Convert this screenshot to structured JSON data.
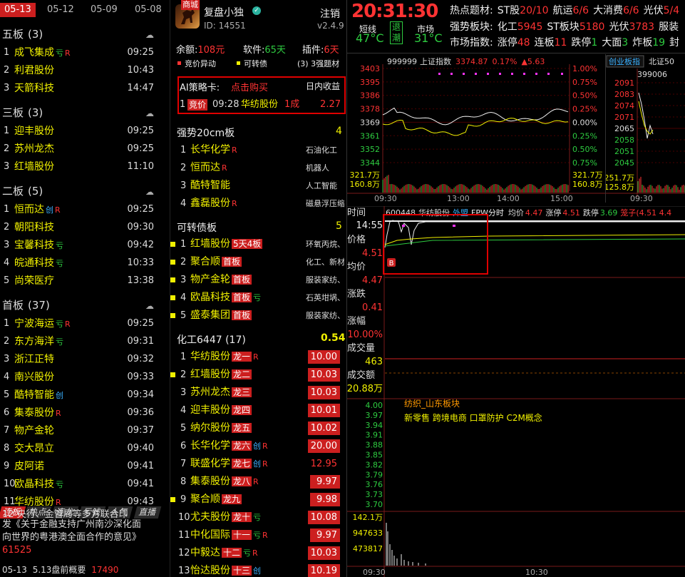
{
  "left": {
    "date_tabs": [
      "05-13",
      "05-12",
      "05-09",
      "05-08"
    ],
    "sections": [
      {
        "title": "五板",
        "count": "(3)",
        "rows": [
          {
            "n": "1",
            "name": "成飞集成",
            "tags": [
              {
                "t": "亏",
                "c": "k"
              },
              {
                "t": "R",
                "c": "r"
              }
            ],
            "time": "09:25"
          },
          {
            "n": "2",
            "name": "利君股份",
            "tags": [],
            "time": "10:43"
          },
          {
            "n": "3",
            "name": "天箭科技",
            "tags": [],
            "time": "14:47"
          }
        ]
      },
      {
        "title": "三板",
        "count": "(3)",
        "rows": [
          {
            "n": "1",
            "name": "迎丰股份",
            "tags": [],
            "time": "09:25"
          },
          {
            "n": "2",
            "name": "苏州龙杰",
            "tags": [],
            "time": "09:25"
          },
          {
            "n": "3",
            "name": "红墙股份",
            "tags": [],
            "time": "11:10"
          }
        ]
      },
      {
        "title": "二板",
        "count": "(5)",
        "rows": [
          {
            "n": "1",
            "name": "恒而达",
            "tags": [
              {
                "t": "创",
                "c": "c"
              },
              {
                "t": "R",
                "c": "r"
              }
            ],
            "time": "09:25"
          },
          {
            "n": "2",
            "name": "朝阳科技",
            "tags": [],
            "time": "09:30"
          },
          {
            "n": "3",
            "name": "宝馨科技",
            "tags": [
              {
                "t": "亏",
                "c": "k"
              }
            ],
            "time": "09:42"
          },
          {
            "n": "4",
            "name": "皖通科技",
            "tags": [
              {
                "t": "亏",
                "c": "k"
              }
            ],
            "time": "10:33"
          },
          {
            "n": "5",
            "name": "尚荣医疗",
            "tags": [],
            "time": "13:38"
          }
        ]
      },
      {
        "title": "首板",
        "count": "(37)",
        "rows": [
          {
            "n": "1",
            "name": "宁波海运",
            "tags": [
              {
                "t": "亏",
                "c": "k"
              },
              {
                "t": "R",
                "c": "r"
              }
            ],
            "time": "09:25"
          },
          {
            "n": "2",
            "name": "东方海洋",
            "tags": [
              {
                "t": "亏",
                "c": "k"
              }
            ],
            "time": "09:31"
          },
          {
            "n": "3",
            "name": "浙江正特",
            "tags": [],
            "time": "09:32"
          },
          {
            "n": "4",
            "name": "南兴股份",
            "tags": [],
            "time": "09:33"
          },
          {
            "n": "5",
            "name": "酷特智能",
            "tags": [
              {
                "t": "创",
                "c": "c"
              }
            ],
            "time": "09:34"
          },
          {
            "n": "6",
            "name": "集泰股份",
            "tags": [
              {
                "t": "R",
                "c": "r"
              }
            ],
            "time": "09:36"
          },
          {
            "n": "7",
            "name": "物产金轮",
            "tags": [],
            "time": "09:37"
          },
          {
            "n": "8",
            "name": "交大昂立",
            "tags": [],
            "time": "09:40"
          },
          {
            "n": "9",
            "name": "皮阿诺",
            "tags": [],
            "time": "09:41"
          },
          {
            "n": "10",
            "name": "欧晶科技",
            "tags": [
              {
                "t": "亏",
                "c": "k"
              }
            ],
            "time": "09:41"
          },
          {
            "n": "11",
            "name": "华纺股份",
            "tags": [
              {
                "t": "R",
                "c": "r"
              }
            ],
            "time": "09:43"
          }
        ]
      }
    ],
    "bottom_tabs": [
      "连板",
      "热点",
      "连龙",
      "亏钱",
      "人气",
      "直播"
    ],
    "news_line1": "发《关于金融支持广州南沙深化面",
    "news_line2": "向世界的粤港澳全面合作的意见》",
    "news_line0": "12 央行、金管局等多方联合印",
    "news_num": "61525",
    "footer_date": "05-13",
    "footer_text": "5.13盘前概要",
    "footer_num": "17490"
  },
  "mid": {
    "shop_badge": "商城",
    "user": "复盘小独",
    "user_id": "ID: 14551",
    "logout": "注销",
    "version": "v2.4.9",
    "balance_label": "余额:",
    "balance_value": "108元",
    "software_label": "软件:",
    "software_value": "65天",
    "plugin_label": "插件:",
    "plugin_value": "6天",
    "legend": [
      {
        "t": "竞价异动",
        "c": "#ff3333"
      },
      {
        "t": "可转债",
        "c": "#f0f000"
      },
      {
        "t": "(3) 3强题材",
        "c": "#eee"
      }
    ],
    "ai_label": "AI策略卡:",
    "ai_buy": "点击购买",
    "ai_income": "日内收益",
    "ai_row": {
      "badge": "竞价",
      "time": "09:28",
      "name": "华纺股份",
      "share": "1成",
      "ret": "2.27"
    },
    "strong20_title": "强势20cm板",
    "strong20_count": "4",
    "strong20": [
      {
        "n": "1",
        "name": "长华化学",
        "tag": "R",
        "ind": "石油化工"
      },
      {
        "n": "2",
        "name": "恒而达",
        "tag": "R",
        "ind": "机器人"
      },
      {
        "n": "3",
        "name": "酷特智能",
        "tag": "",
        "ind": "人工智能"
      },
      {
        "n": "4",
        "name": "鑫磊股份",
        "tag": "R",
        "ind": "磁悬浮压缩"
      }
    ],
    "bond_title": "可转债板",
    "bond_count": "5",
    "bonds": [
      {
        "n": "1",
        "name": "红墙股份",
        "badge": "5天4板",
        "tag": "",
        "ind": "环氧丙烷、"
      },
      {
        "n": "2",
        "name": "聚合顺",
        "badge": "首板",
        "tag": "",
        "ind": "化工、新材"
      },
      {
        "n": "3",
        "name": "物产金轮",
        "badge": "首板",
        "tag": "",
        "ind": "服装家纺、"
      },
      {
        "n": "4",
        "name": "欧晶科技",
        "badge": "首板",
        "tag": "亏",
        "ind": "石英坩埚、"
      },
      {
        "n": "5",
        "name": "盛泰集团",
        "badge": "首板",
        "tag": "",
        "ind": "服装家纺、"
      }
    ],
    "chem_title": "化工6447",
    "chem_count": "(17)",
    "chem_pct": "0.54",
    "chem": [
      {
        "n": "1",
        "name": "华纺股份",
        "badge": "龙一",
        "tags": [
          {
            "t": "R",
            "c": "r"
          }
        ],
        "pct": "10.00",
        "sq": false,
        "plain": false
      },
      {
        "n": "2",
        "name": "红墙股份",
        "badge": "龙二",
        "tags": [],
        "pct": "10.03",
        "sq": true,
        "plain": false
      },
      {
        "n": "3",
        "name": "苏州龙杰",
        "badge": "龙三",
        "tags": [],
        "pct": "10.03",
        "sq": false,
        "plain": false
      },
      {
        "n": "4",
        "name": "迎丰股份",
        "badge": "龙四",
        "tags": [],
        "pct": "10.01",
        "sq": false,
        "plain": false
      },
      {
        "n": "5",
        "name": "纳尔股份",
        "badge": "龙五",
        "tags": [],
        "pct": "10.02",
        "sq": false,
        "plain": false
      },
      {
        "n": "6",
        "name": "长华化学",
        "badge": "龙六",
        "tags": [
          {
            "t": "创",
            "c": "c"
          },
          {
            "t": "R",
            "c": "r"
          }
        ],
        "pct": "20.00",
        "sq": false,
        "plain": false
      },
      {
        "n": "7",
        "name": "联盛化学",
        "badge": "龙七",
        "tags": [
          {
            "t": "创",
            "c": "c"
          },
          {
            "t": "R",
            "c": "r"
          }
        ],
        "pct": "12.95",
        "sq": false,
        "plain": true
      },
      {
        "n": "8",
        "name": "集泰股份",
        "badge": "龙八",
        "tags": [
          {
            "t": "R",
            "c": "r"
          }
        ],
        "pct": "9.97",
        "sq": false,
        "plain": false
      },
      {
        "n": "9",
        "name": "聚合顺",
        "badge": "龙九",
        "tags": [],
        "pct": "9.98",
        "sq": true,
        "plain": false
      },
      {
        "n": "10",
        "name": "尤夫股份",
        "badge": "龙十",
        "tags": [
          {
            "t": "亏",
            "c": "k"
          }
        ],
        "pct": "10.08",
        "sq": false,
        "plain": false
      },
      {
        "n": "11",
        "name": "中化国际",
        "badge": "十一",
        "tags": [
          {
            "t": "亏",
            "c": "k"
          },
          {
            "t": "R",
            "c": "r"
          }
        ],
        "pct": "9.97",
        "sq": false,
        "plain": false
      },
      {
        "n": "12",
        "name": "中毅达",
        "badge": "十二",
        "tags": [
          {
            "t": "亏",
            "c": "k"
          },
          {
            "t": "R",
            "c": "r"
          }
        ],
        "pct": "10.03",
        "sq": false,
        "plain": false
      },
      {
        "n": "13",
        "name": "怡达股份",
        "badge": "十三",
        "tags": [
          {
            "t": "创",
            "c": "c"
          }
        ],
        "pct": "10.19",
        "sq": false,
        "plain": false
      }
    ]
  },
  "right": {
    "clock": "20:31:30",
    "short_label": "短线",
    "short_temp": "47°C",
    "retreat": "退",
    "tide": "潮",
    "market_label": "市场",
    "market_temp": "31°C",
    "hot_label": "热点题材:",
    "hot": [
      {
        "name": "ST股",
        "val": "20/10"
      },
      {
        "name": "航运",
        "val": "6/6"
      },
      {
        "name": "大消费",
        "val": "6/6"
      },
      {
        "name": "光伏",
        "val": "5/4"
      }
    ],
    "strong_label": "强势板块:",
    "strong": [
      {
        "name": "化工",
        "val": "5945"
      },
      {
        "name": "ST板块",
        "val": "5180"
      },
      {
        "name": "光伏",
        "val": "3783"
      },
      {
        "name": "服装",
        "val": ""
      }
    ],
    "index_label": "市场指数:",
    "index": [
      {
        "name": "涨停",
        "val": "48",
        "c": "red"
      },
      {
        "name": "连板",
        "val": "11",
        "c": "red"
      },
      {
        "name": "跌停",
        "val": "1",
        "c": "green"
      },
      {
        "name": "大面",
        "val": "3",
        "c": "green"
      },
      {
        "name": "炸板",
        "val": "19",
        "c": "green"
      },
      {
        "name": "封",
        "val": "",
        "c": "red"
      }
    ],
    "sh": {
      "code": "999999",
      "name": "上证指数",
      "price": "3374.87",
      "pct": "0.17%",
      "chg": "▲5.63",
      "left_ticks": [
        "3403",
        "3395",
        "3386",
        "3378",
        "3369",
        "3361",
        "3352",
        "3344"
      ],
      "right_ticks": [
        "1.00%",
        "0.75%",
        "0.50%",
        "0.25%",
        "0.00%",
        "0.25%",
        "0.50%",
        "0.75%"
      ],
      "vol_left": [
        "321.7万",
        "160.8万"
      ],
      "vol_right": [
        "321.7万",
        "160.8万"
      ],
      "time_ticks": [
        "09:30",
        "13:00",
        "14:00",
        "15:00"
      ]
    },
    "cyb": {
      "tab1": "创业板指",
      "tab2": "北证50",
      "code": "399006",
      "ticks": [
        "2091",
        "2083",
        "2074",
        "2071",
        "2065",
        "2058",
        "2051",
        "2045"
      ],
      "vol": [
        "251.7万",
        "125.8万"
      ],
      "time_ticks": [
        "09:30"
      ]
    },
    "fs": {
      "code": "600448",
      "name": "华纺股份",
      "tag": "外盟",
      "mode": "FPW分时",
      "avg_label": "均价",
      "avg": "4.47",
      "up_label": "涨停",
      "up": "4.51",
      "down_label": "跌停",
      "down": "3.69",
      "box": "笼子(4.51 4.4",
      "time_label": "时间",
      "time": "14:55",
      "price_label": "价格",
      "price": "4.51",
      "avgp_label": "均价",
      "avgp": "4.47",
      "zd_label": "涨跌",
      "zd": "0.41",
      "zf_label": "涨幅",
      "zf": "10.00%",
      "cjl_label": "成交量",
      "cjl": "463",
      "cje_label": "成交额",
      "cje": "20.88万",
      "y_ticks": [
        "4.00",
        "3.97",
        "3.94",
        "3.91",
        "3.88",
        "3.85",
        "3.82",
        "3.79",
        "3.76",
        "3.73",
        "3.70"
      ],
      "vol_ticks": [
        "142.1万",
        "947633",
        "473817"
      ],
      "time_ticks": [
        "09:30",
        "10:30"
      ],
      "concept1": "纺织_山东板块",
      "concept2": "新零售 跨境电商 口罩防护 C2M概念",
      "marker": "B"
    }
  },
  "colors": {
    "red": "#ff3333",
    "yellow": "#f0f000",
    "green": "#2ecc40",
    "badge": "#cc1f1f"
  }
}
